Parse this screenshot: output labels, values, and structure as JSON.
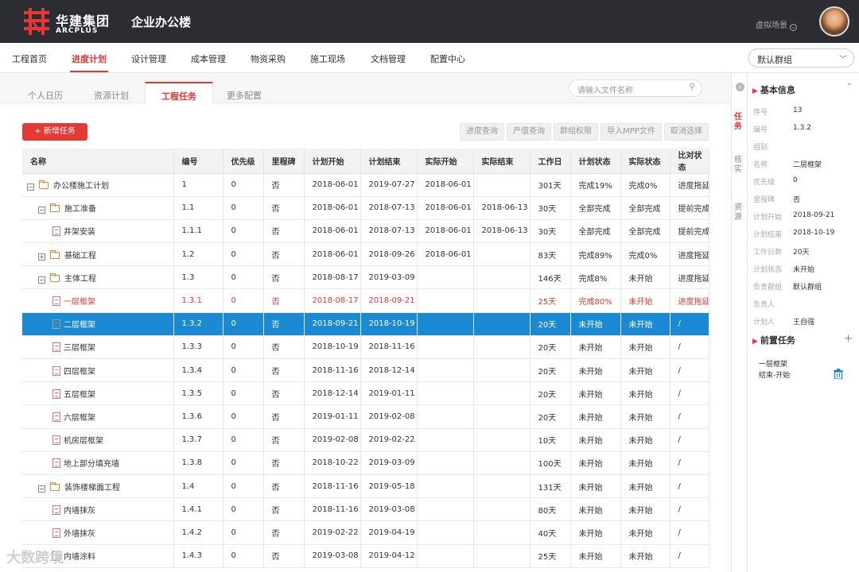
{
  "header": {
    "logo_cn": "华建集团",
    "logo_en": "ARCPLUS",
    "app_title": "企业办公楼",
    "scene": "虚拟场景"
  },
  "nav": {
    "items": [
      "工程首页",
      "进度计划",
      "设计管理",
      "成本管理",
      "物资采购",
      "施工现场",
      "文档管理",
      "配置中心"
    ],
    "active": "进度计划",
    "group": "默认群组"
  },
  "subtabs": {
    "items": [
      "个人日历",
      "资源计划",
      "工程任务",
      "更多配置"
    ],
    "active": "工程任务"
  },
  "search": {
    "placeholder": "请输入文件名称"
  },
  "toolbar": {
    "add": "+ 新增任务",
    "buttons": [
      "进度查询",
      "产值查询",
      "群组权限",
      "导入MPP文件",
      "取消选择"
    ]
  },
  "table": {
    "headers": [
      "名称",
      "编号",
      "优先级",
      "里程碑",
      "计划开始",
      "计划结束",
      "实际开始",
      "实际结束",
      "工作日",
      "计划状态",
      "实际状态",
      "比对状态"
    ],
    "rows": [
      {
        "name": "办公楼施工计划",
        "toggle": "−",
        "icon": "folder",
        "level": 0,
        "cells": [
          "1",
          "0",
          "否",
          "2018-06-01",
          "2019-07-27",
          "2018-06-01",
          "",
          "301天",
          "完成19%",
          "完成0%",
          "进度拖延"
        ]
      },
      {
        "name": "施工准备",
        "toggle": "−",
        "icon": "folder",
        "level": 1,
        "cells": [
          "1.1",
          "0",
          "否",
          "2018-06-01",
          "2018-07-13",
          "2018-06-01",
          "2018-06-13",
          "30天",
          "全部完成",
          "全部完成",
          "提前完成"
        ]
      },
      {
        "name": "井架安装",
        "toggle": "",
        "icon": "doc",
        "level": 2,
        "cells": [
          "1.1.1",
          "0",
          "否",
          "2018-06-01",
          "2018-07-13",
          "2018-06-01",
          "2018-06-13",
          "30天",
          "全部完成",
          "全部完成",
          "提前完成"
        ]
      },
      {
        "name": "基础工程",
        "toggle": "+",
        "icon": "folder",
        "level": 1,
        "cells": [
          "1.2",
          "0",
          "否",
          "2018-06-01",
          "2018-09-26",
          "2018-06-01",
          "",
          "83天",
          "完成89%",
          "完成0%",
          "进度拖延"
        ]
      },
      {
        "name": "主体工程",
        "toggle": "−",
        "icon": "folder",
        "level": 1,
        "cells": [
          "1.3",
          "0",
          "否",
          "2018-08-17",
          "2019-03-09",
          "",
          "",
          "146天",
          "完成8%",
          "未开始",
          "进度拖延"
        ]
      },
      {
        "name": "一层框架",
        "toggle": "",
        "icon": "doc",
        "level": 2,
        "style": "red",
        "cells": [
          "1.3.1",
          "0",
          "否",
          "2018-08-17",
          "2018-09-21",
          "",
          "",
          "25天",
          "完成80%",
          "未开始",
          "进度拖延"
        ]
      },
      {
        "name": "二层框架",
        "toggle": "",
        "icon": "doc",
        "level": 2,
        "style": "sel",
        "cells": [
          "1.3.2",
          "0",
          "否",
          "2018-09-21",
          "2018-10-19",
          "",
          "",
          "20天",
          "未开始",
          "未开始",
          "/"
        ]
      },
      {
        "name": "三层框架",
        "toggle": "",
        "icon": "doc",
        "level": 2,
        "cells": [
          "1.3.3",
          "0",
          "否",
          "2018-10-19",
          "2018-11-16",
          "",
          "",
          "20天",
          "未开始",
          "未开始",
          "/"
        ]
      },
      {
        "name": "四层框架",
        "toggle": "",
        "icon": "doc",
        "level": 2,
        "cells": [
          "1.3.4",
          "0",
          "否",
          "2018-11-16",
          "2018-12-14",
          "",
          "",
          "20天",
          "未开始",
          "未开始",
          "/"
        ]
      },
      {
        "name": "五层框架",
        "toggle": "",
        "icon": "doc",
        "level": 2,
        "cells": [
          "1.3.5",
          "0",
          "否",
          "2018-12-14",
          "2019-01-11",
          "",
          "",
          "20天",
          "未开始",
          "未开始",
          "/"
        ]
      },
      {
        "name": "六层框架",
        "toggle": "",
        "icon": "doc",
        "level": 2,
        "cells": [
          "1.3.6",
          "0",
          "否",
          "2019-01-11",
          "2019-02-08",
          "",
          "",
          "20天",
          "未开始",
          "未开始",
          "/"
        ]
      },
      {
        "name": "机房层框架",
        "toggle": "",
        "icon": "doc",
        "level": 2,
        "cells": [
          "1.3.7",
          "0",
          "否",
          "2019-02-08",
          "2019-02-22",
          "",
          "",
          "10天",
          "未开始",
          "未开始",
          "/"
        ]
      },
      {
        "name": "地上部分填充墙",
        "toggle": "",
        "icon": "doc",
        "level": 2,
        "cells": [
          "1.3.8",
          "0",
          "否",
          "2018-10-22",
          "2019-03-09",
          "",
          "",
          "100天",
          "未开始",
          "未开始",
          "/"
        ]
      },
      {
        "name": "装饰楼梯面工程",
        "toggle": "−",
        "icon": "folder",
        "level": 1,
        "cells": [
          "1.4",
          "0",
          "否",
          "2018-11-16",
          "2019-05-18",
          "",
          "",
          "131天",
          "未开始",
          "未开始",
          "/"
        ]
      },
      {
        "name": "内墙抹灰",
        "toggle": "",
        "icon": "doc",
        "level": 2,
        "cells": [
          "1.4.1",
          "0",
          "否",
          "2018-11-16",
          "2019-03-08",
          "",
          "",
          "80天",
          "未开始",
          "未开始",
          "/"
        ]
      },
      {
        "name": "外墙抹灰",
        "toggle": "",
        "icon": "doc",
        "level": 2,
        "cells": [
          "1.4.2",
          "0",
          "否",
          "2019-02-22",
          "2019-04-19",
          "",
          "",
          "40天",
          "未开始",
          "未开始",
          "/"
        ]
      },
      {
        "name": "内墙涂料",
        "toggle": "",
        "icon": "doc",
        "level": 2,
        "cells": [
          "1.4.3",
          "0",
          "否",
          "2019-03-08",
          "2019-04-12",
          "",
          "",
          "25天",
          "未开始",
          "未开始",
          "/"
        ]
      }
    ]
  },
  "side_tabs": [
    "任务",
    "核实",
    "资源"
  ],
  "detail": {
    "title": "基本信息",
    "fields": [
      {
        "label": "序号",
        "value": "13"
      },
      {
        "label": "编号",
        "value": "1.3.2"
      },
      {
        "label": "组别",
        "value": ""
      },
      {
        "label": "名称",
        "value": "二层框架"
      },
      {
        "label": "优先级",
        "value": "0"
      },
      {
        "label": "里程碑",
        "value": "否"
      },
      {
        "label": "计划开始",
        "value": "2018-09-21"
      },
      {
        "label": "计划结束",
        "value": "2018-10-19"
      },
      {
        "label": "工作日数",
        "value": "20天"
      },
      {
        "label": "计划状态",
        "value": "未开始"
      },
      {
        "label": "负责群组",
        "value": "默认群组"
      },
      {
        "label": "负责人",
        "value": ""
      },
      {
        "label": "计划人",
        "value": "王自强"
      }
    ],
    "pre_title": "前置任务",
    "pre_name": "一层框架",
    "pre_rel": "结束-开始"
  },
  "watermark": "大数跨境",
  "colors": {
    "accent": "#e53935",
    "selection": "#1b8ad3",
    "topbar": "#2b2d33"
  }
}
